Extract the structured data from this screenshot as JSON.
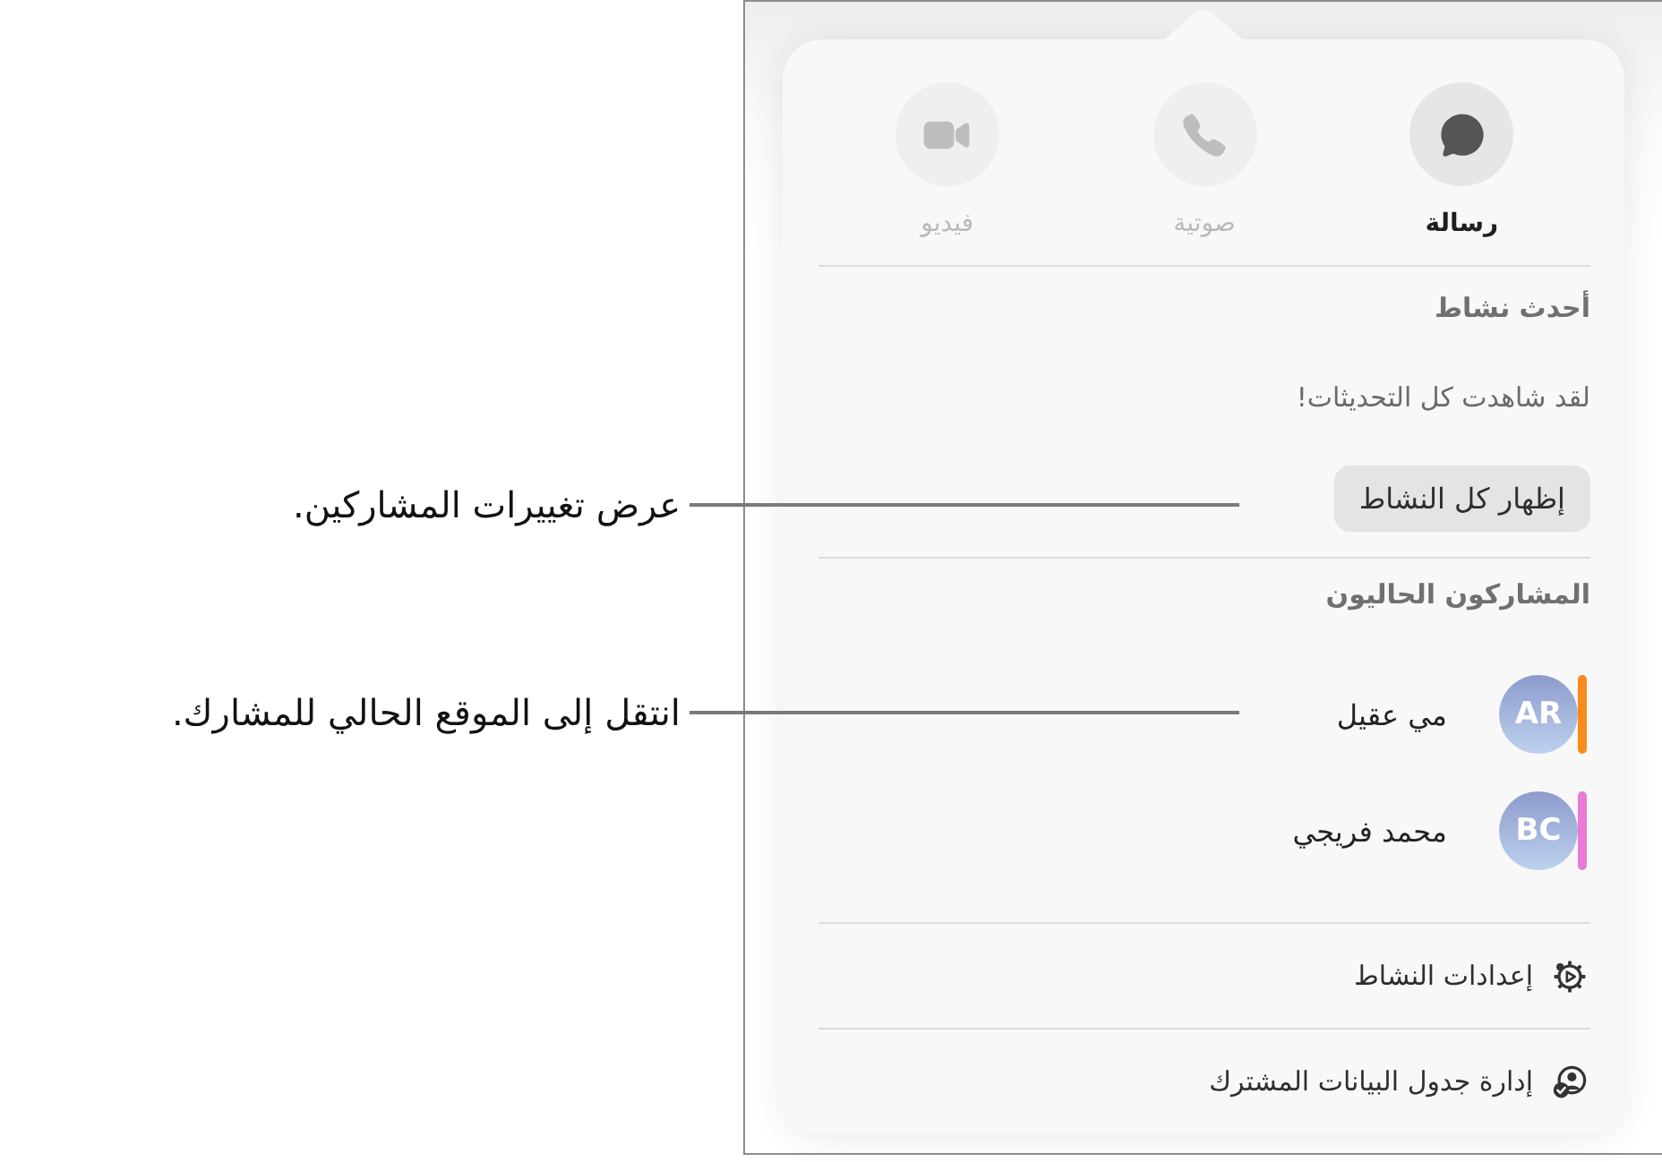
{
  "callouts": [
    {
      "text": "عرض تغييرات المشاركين."
    },
    {
      "text": "انتقل إلى الموقع الحالي للمشارك."
    }
  ],
  "popover": {
    "actions": [
      {
        "kind": "message",
        "label": "رسالة",
        "disabled": false
      },
      {
        "kind": "audio",
        "label": "صوتية",
        "disabled": true
      },
      {
        "kind": "video",
        "label": "فيديو",
        "disabled": true
      }
    ],
    "recent_activity": {
      "heading": "أحدث نشاط",
      "message": "لقد شاهدت كل التحديثات!",
      "button": "إظهار كل النشاط"
    },
    "participants": {
      "heading": "المشاركون الحاليون",
      "items": [
        {
          "initials": "AR",
          "name": "مي عقيل",
          "color": "#f98b1c"
        },
        {
          "initials": "BC",
          "name": "محمد فريجي",
          "color": "#e97ad9"
        }
      ]
    },
    "menu": [
      {
        "kind": "settings",
        "label": "إعدادات النشاط"
      },
      {
        "kind": "manage",
        "label": "إدارة جدول البيانات المشترك"
      }
    ]
  }
}
